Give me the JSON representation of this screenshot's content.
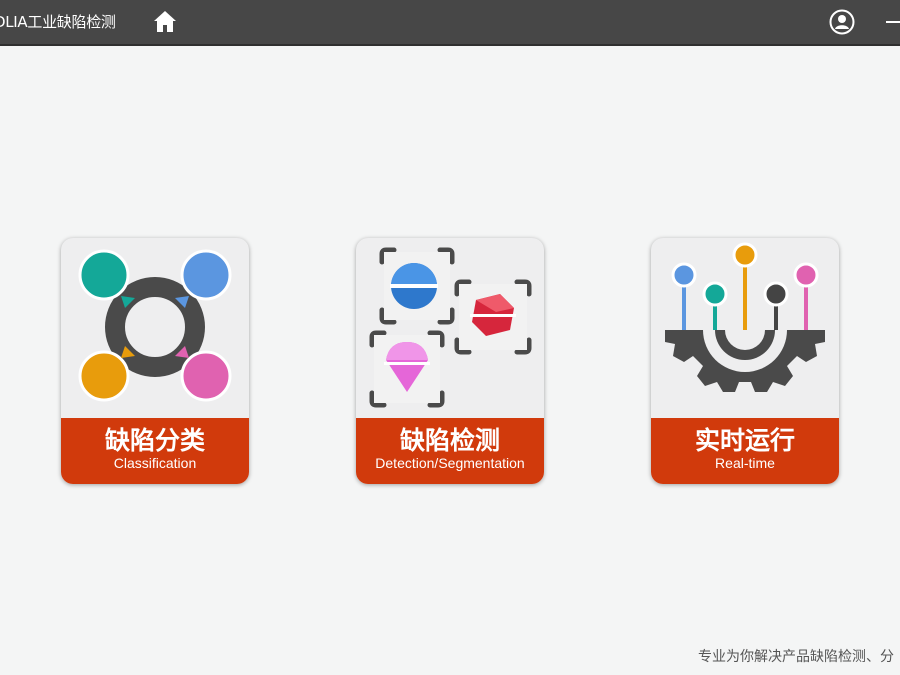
{
  "header": {
    "app_title": "DLIA工业缺陷检测",
    "home_icon": "home-icon",
    "user_icon": "user-account-icon",
    "minimize_icon": "minimize-icon",
    "background_color": "#474747"
  },
  "cards": [
    {
      "title": "缺陷分类",
      "subtitle": "Classification",
      "icon": "classification-cycle-icon",
      "colors": [
        "#14a898",
        "#5b96e0",
        "#e89c0c",
        "#e062b0"
      ]
    },
    {
      "title": "缺陷检测",
      "subtitle": "Detection/Segmentation",
      "icon": "detection-targets-icon",
      "colors": [
        "#2e78cc",
        "#d6263c",
        "#e566d8"
      ]
    },
    {
      "title": "实时运行",
      "subtitle": "Real-time",
      "icon": "realtime-gear-icon",
      "colors": [
        "#5b96e0",
        "#14a898",
        "#e89c0c",
        "#444444",
        "#e062b0"
      ]
    }
  ],
  "accent_color": "#d13a0c",
  "footer": {
    "text": "专业为你解决产品缺陷检测、分"
  }
}
